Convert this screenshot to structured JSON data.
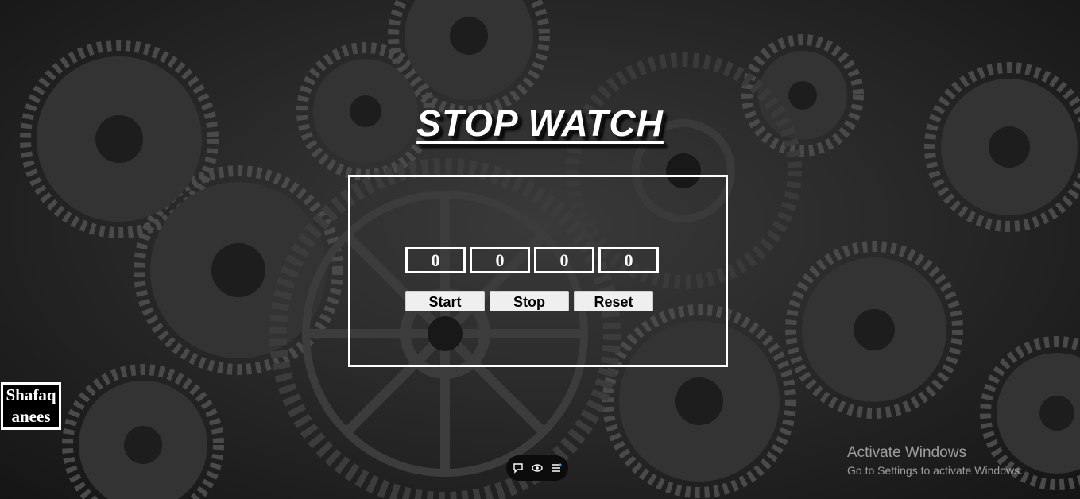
{
  "title": "STOP WATCH",
  "counters": [
    {
      "value": "0"
    },
    {
      "value": "0"
    },
    {
      "value": "0"
    },
    {
      "value": "0"
    }
  ],
  "buttons": {
    "start_label": "Start",
    "stop_label": "Stop",
    "reset_label": "Reset"
  },
  "author": {
    "line1": "Shafaq",
    "line2": "anees"
  },
  "windows_overlay": {
    "line1": "Activate Windows",
    "line2": "Go to Settings to activate Windows."
  },
  "toolbar_icons": [
    "chat-icon",
    "eye-icon",
    "menu-icon"
  ],
  "colors": {
    "border": "#ffffff",
    "button_bg": "#efefef",
    "background": "#262626"
  }
}
